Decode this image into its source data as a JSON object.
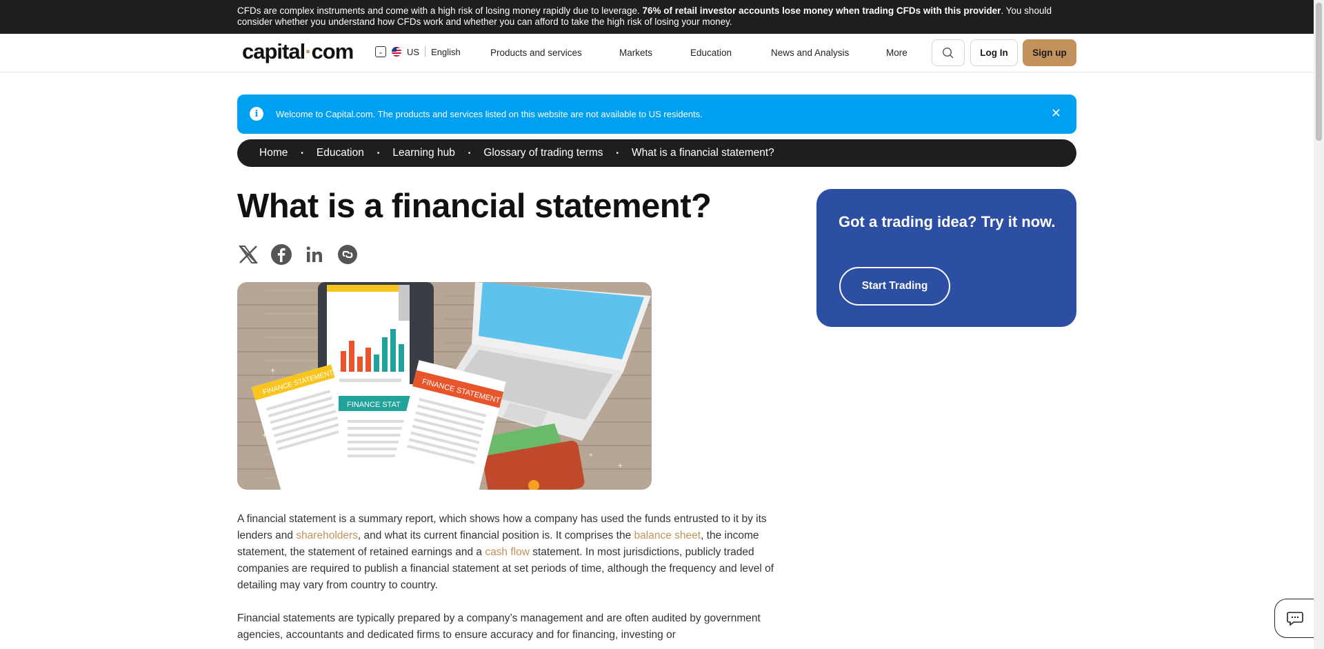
{
  "risk_warning": {
    "text_start": "CFDs are complex instruments and come with a high risk of losing money rapidly due to leverage. ",
    "text_bold": "76% of retail investor accounts lose money when trading CFDs with this provider",
    "text_end": ". You should consider whether you understand how CFDs work and whether you can afford to take the high risk of losing your money."
  },
  "header": {
    "logo_part1": "capital",
    "logo_dot": "·",
    "logo_part2": "com",
    "region": "US",
    "language": "English",
    "nav": [
      "Products and services",
      "Markets",
      "Education",
      "News and Analysis",
      "More"
    ],
    "login": "Log In",
    "signup": "Sign up"
  },
  "notice": {
    "icon": "i",
    "message": "Welcome to Capital.com. The products and services listed on this website are not available to US residents.",
    "close": "✕"
  },
  "breadcrumb": [
    "Home",
    "Education",
    "Learning hub",
    "Glossary of trading terms",
    "What is a financial statement?"
  ],
  "article": {
    "title": "What is a financial statement?",
    "p1_a": "A financial statement is a summary report, which shows how a company has used the funds entrusted to it by its lenders and ",
    "p1_link1": "shareholders",
    "p1_b": ", and what its current financial position is. It comprises the ",
    "p1_link2": "balance sheet",
    "p1_c": ", the income statement, the statement of retained earnings and a ",
    "p1_link3": "cash flow",
    "p1_d": " statement. In most jurisdictions, publicly traded companies are required to publish a financial statement at set periods of time, although the frequency and level of detailing may vary from country to country.",
    "p2": "Financial statements are typically prepared by a company’s management and are often audited by government agencies, accountants and dedicated firms to ensure accuracy and for financing, investing or"
  },
  "hero_image": {
    "doc_label": "FINANCE STATEMENT",
    "doc_label_cut": "FINANCE STAT"
  },
  "cta": {
    "heading": "Got a trading idea? Try it now.",
    "button": "Start Trading"
  },
  "colors": {
    "accent": "#c3915b",
    "notice_blue": "#00a0f0",
    "cta_blue": "#2d4fa3",
    "dark": "#1e1e1e"
  }
}
